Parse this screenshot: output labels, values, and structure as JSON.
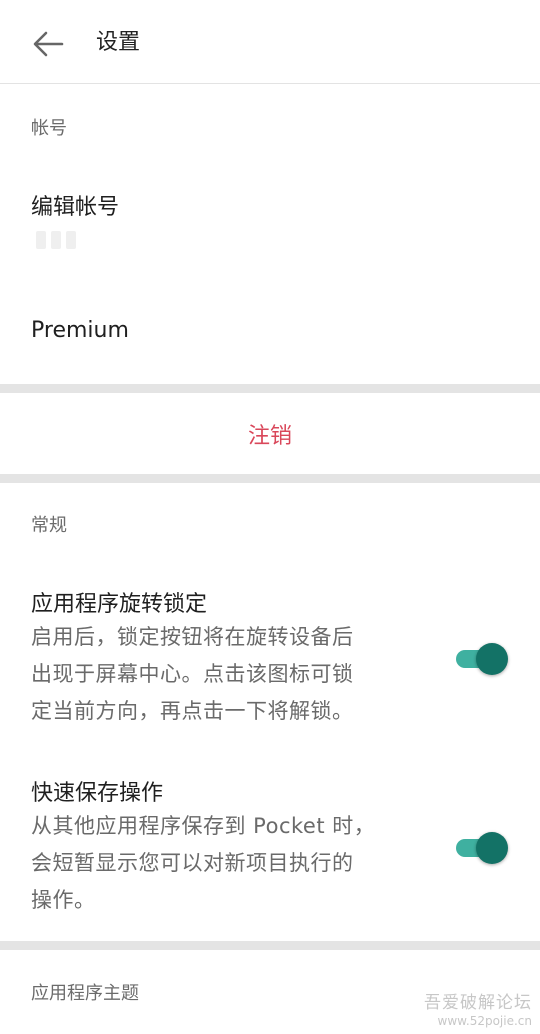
{
  "header": {
    "title": "设置",
    "back_icon": "arrow-left-icon"
  },
  "account_section": {
    "header": "帐号",
    "edit_account_label": "编辑帐号",
    "premium_label": "Premium"
  },
  "logout": {
    "label": "注销",
    "color": "#d9475a"
  },
  "general_section": {
    "header": "常规",
    "rotation_lock": {
      "title": "应用程序旋转锁定",
      "description_lines": [
        "启用后，锁定按钮将在旋转设备后",
        "出现于屏幕中心。点击该图标可锁",
        "定当前方向，再点击一下将解锁。"
      ],
      "enabled": true
    },
    "quick_save": {
      "title": "快速保存操作",
      "description_lines": [
        "从其他应用程序保存到 Pocket 时，",
        "会短暂显示您可以对新项目执行的",
        "操作。"
      ],
      "enabled": true
    }
  },
  "theme_section": {
    "header": "应用程序主题"
  },
  "watermark": {
    "line1": "吾爱破解论坛",
    "line2": "www.52pojie.cn"
  },
  "colors": {
    "toggle_track": "#3fb0a0",
    "toggle_thumb": "#137266",
    "divider": "#e4e4e4"
  }
}
